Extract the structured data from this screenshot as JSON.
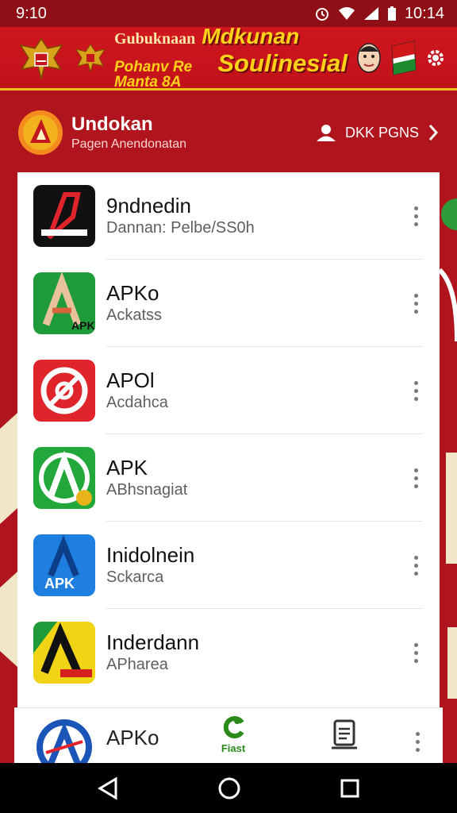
{
  "status_bar": {
    "time": "9:10",
    "right_time": "10:14"
  },
  "banner": {
    "line1_small": "Gubuknaan",
    "line1_big": "Mdkunan",
    "line2_small": "Pohanv Re Manta 8A",
    "line2_big": "Soulinesial"
  },
  "header": {
    "title": "Undokan",
    "subtitle": "Pagen Anendonatan",
    "points_label": "DKK PGNS"
  },
  "apps": [
    {
      "title": "9ndnedin",
      "subtitle": "Dannan: Pelbe/SS0h",
      "icon": "dark-a-logo-icon",
      "color": "#111111"
    },
    {
      "title": "APKo",
      "subtitle": "Ackatss",
      "icon": "green-a-logo-icon",
      "color": "#1f9b3a"
    },
    {
      "title": "APOl",
      "subtitle": "Acdahca",
      "icon": "red-target-logo-icon",
      "color": "#e0242b"
    },
    {
      "title": "APK",
      "subtitle": "ABhsnagiat",
      "icon": "green-circle-a-logo-icon",
      "color": "#22a83a"
    },
    {
      "title": "Inidolnein",
      "subtitle": "Sckarca",
      "icon": "blue-apk-logo-icon",
      "color": "#1f7fe0"
    },
    {
      "title": "Inderdann",
      "subtitle": "APharea",
      "icon": "yellow-green-a-logo-icon",
      "color": "#f1d416"
    }
  ],
  "bottom": {
    "partial_title": "APKo",
    "home_tab_label": "Fiast"
  },
  "colors": {
    "primary_red": "#b0141c",
    "accent_gold": "#ffd21a",
    "tab_green": "#2a8a1a"
  }
}
